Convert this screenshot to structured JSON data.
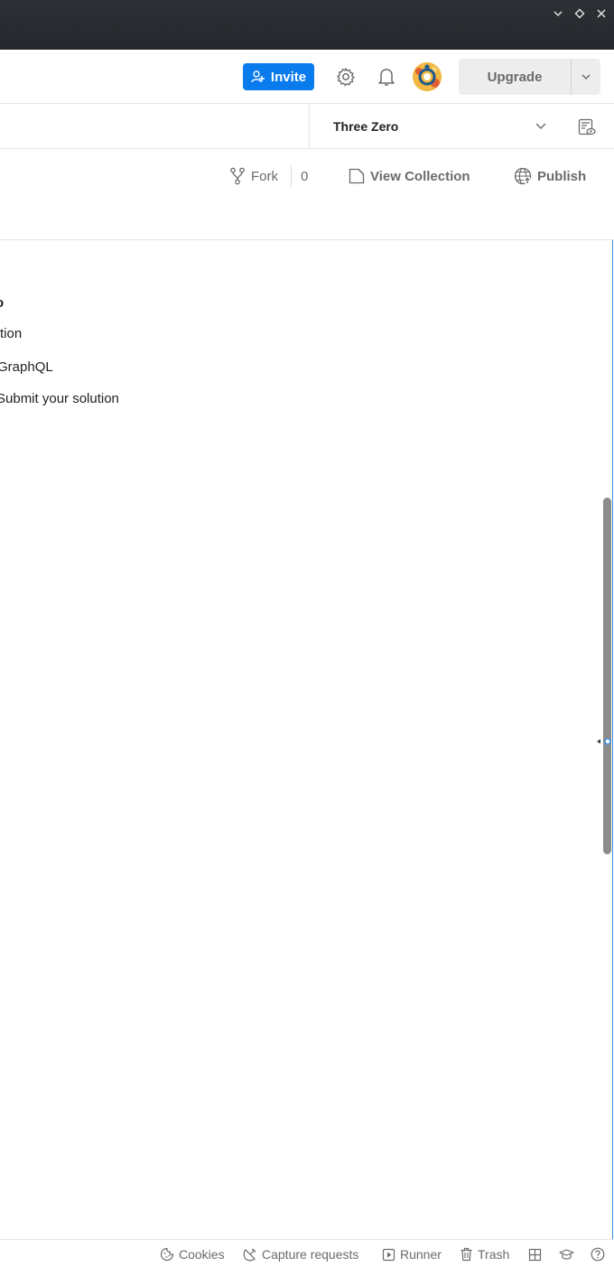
{
  "header": {
    "invite_label": "Invite",
    "upgrade_label": "Upgrade"
  },
  "environment": {
    "selected": "Three Zero"
  },
  "actions": {
    "fork_label": "Fork",
    "fork_count": "0",
    "view_collection_label": "View Collection",
    "publish_label": "Publish"
  },
  "content": {
    "lines": [
      "o",
      "tion",
      "GraphQL",
      "Submit your solution"
    ]
  },
  "footer": {
    "cookies_label": "Cookies",
    "capture_label": "Capture requests",
    "runner_label": "Runner",
    "trash_label": "Trash"
  },
  "colors": {
    "accent": "#097bed",
    "titlebar": "#2d3035"
  }
}
